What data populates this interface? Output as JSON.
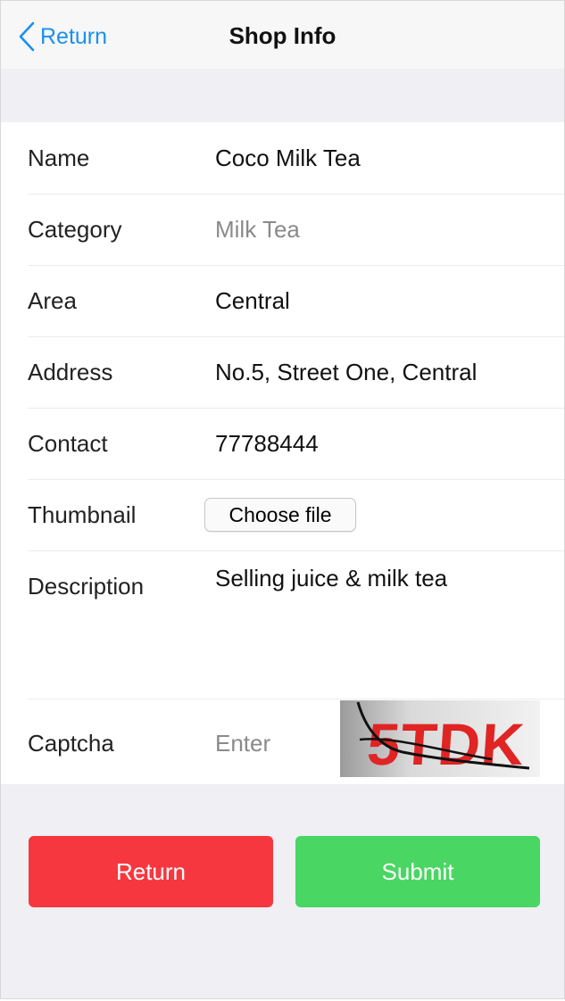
{
  "nav": {
    "back_label": "Return",
    "title": "Shop Info"
  },
  "form": {
    "name": {
      "label": "Name",
      "value": "Coco Milk Tea"
    },
    "category": {
      "label": "Category",
      "value": "Milk Tea"
    },
    "area": {
      "label": "Area",
      "value": "Central"
    },
    "address": {
      "label": "Address",
      "value": "No.5, Street One, Central"
    },
    "contact": {
      "label": "Contact",
      "value": "77788444"
    },
    "thumbnail": {
      "label": "Thumbnail",
      "button": "Choose file"
    },
    "description": {
      "label": "Description",
      "value": "Selling juice & milk tea"
    },
    "captcha": {
      "label": "Captcha",
      "placeholder": "Enter",
      "image_text": "5TDK"
    }
  },
  "actions": {
    "return_label": "Return",
    "submit_label": "Submit"
  },
  "colors": {
    "accent": "#1a8ff2",
    "return_button": "#f7373f",
    "submit_button": "#49d662",
    "background": "#efeff4"
  },
  "icons": {
    "back": "chevron-left-icon"
  }
}
